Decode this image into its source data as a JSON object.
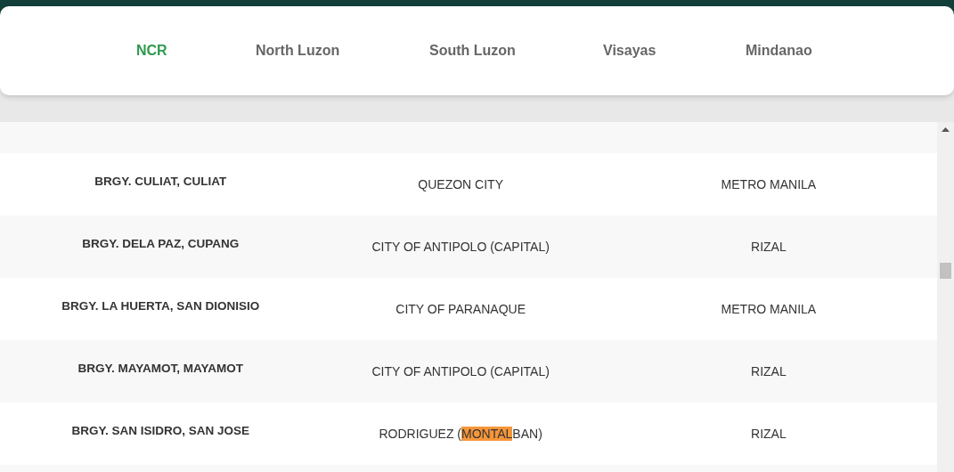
{
  "tabs": [
    {
      "label": "NCR",
      "selected": true
    },
    {
      "label": "North Luzon",
      "selected": false
    },
    {
      "label": "South Luzon",
      "selected": false
    },
    {
      "label": "Visayas",
      "selected": false
    },
    {
      "label": "Mindanao",
      "selected": false
    }
  ],
  "table": {
    "rows": [
      {
        "barangay": "BRGY. CULIAT, CULIAT",
        "city": [
          {
            "text": "QUEZON CITY",
            "highlighted": false
          }
        ],
        "province": "METRO MANILA"
      },
      {
        "barangay": "BRGY. DELA PAZ, CUPANG",
        "city": [
          {
            "text": "CITY OF ANTIPOLO (CAPITAL)",
            "highlighted": false
          }
        ],
        "province": "RIZAL"
      },
      {
        "barangay": "BRGY. LA HUERTA, SAN DIONISIO",
        "city": [
          {
            "text": "CITY OF PARANAQUE",
            "highlighted": false
          }
        ],
        "province": "METRO MANILA"
      },
      {
        "barangay": "BRGY. MAYAMOT, MAYAMOT",
        "city": [
          {
            "text": "CITY OF ANTIPOLO (CAPITAL)",
            "highlighted": false
          }
        ],
        "province": "RIZAL"
      },
      {
        "barangay": "BRGY. SAN ISIDRO, SAN JOSE",
        "city": [
          {
            "text": "RODRIGUEZ (",
            "highlighted": false
          },
          {
            "text": "MONTAL",
            "highlighted": true
          },
          {
            "text": "BAN)",
            "highlighted": false
          }
        ],
        "province": "RIZAL"
      }
    ]
  }
}
